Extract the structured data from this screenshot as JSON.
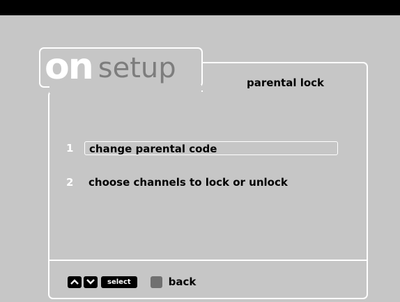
{
  "brand": {
    "logo_text": "on",
    "section": "setup"
  },
  "screen_title": "parental lock",
  "menu": [
    {
      "number": "1",
      "label": "change parental code",
      "selected": true
    },
    {
      "number": "2",
      "label": "choose channels to lock or unlock",
      "selected": false
    }
  ],
  "footer": {
    "up_icon": "chevron-up-icon",
    "down_icon": "chevron-down-icon",
    "select_label": "select",
    "back_label": "back",
    "back_button_color": "#707070"
  },
  "colors": {
    "background": "#c6c6c6",
    "outline": "#ffffff",
    "text": "#000000"
  }
}
